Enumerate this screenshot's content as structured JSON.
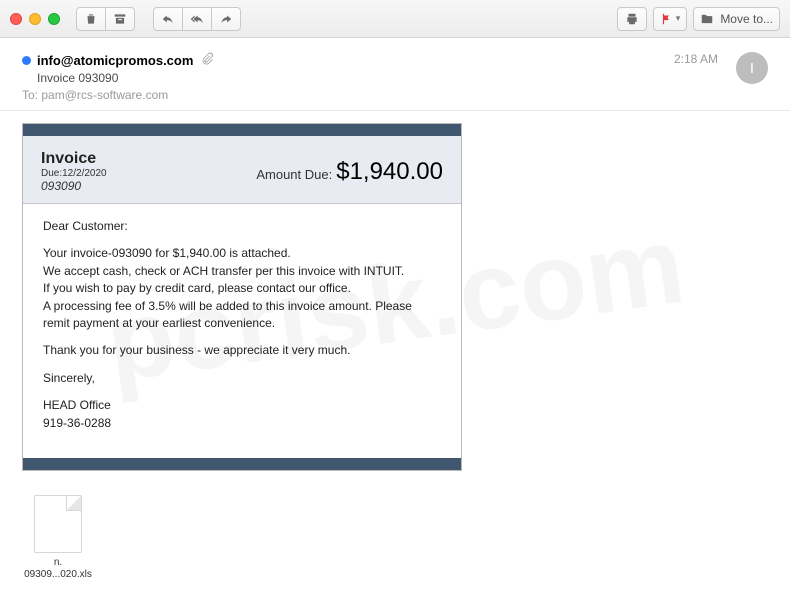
{
  "toolbar": {
    "move_label": "Move to..."
  },
  "header": {
    "from": "info@atomicpromos.com",
    "subject": "Invoice 093090",
    "to_label": "To:",
    "to_value": "pam@rcs-software.com",
    "time": "2:18 AM",
    "avatar_initial": "I"
  },
  "invoice": {
    "title": "Invoice",
    "due_label": "Due:12/2/2020",
    "number": "093090",
    "amount_label": "Amount Due:",
    "amount": "$1,940.00",
    "greeting": "Dear Customer:",
    "line1": "Your invoice-093090 for $1,940.00 is attached.",
    "line2": "We accept cash, check or ACH transfer per this invoice with INTUIT.",
    "line3": "If you wish to pay by credit card, please contact our office.",
    "line4": "A processing fee of 3.5% will be added to this invoice amount. Please remit payment at your earliest convenience.",
    "thanks": "Thank you for your business - we appreciate it very much.",
    "signoff": "Sincerely,",
    "sender_name": "HEAD Office",
    "sender_phone": "919-36-0288"
  },
  "attachment": {
    "display_name_line1": "n.",
    "display_name_line2": "09309...020.xls"
  }
}
